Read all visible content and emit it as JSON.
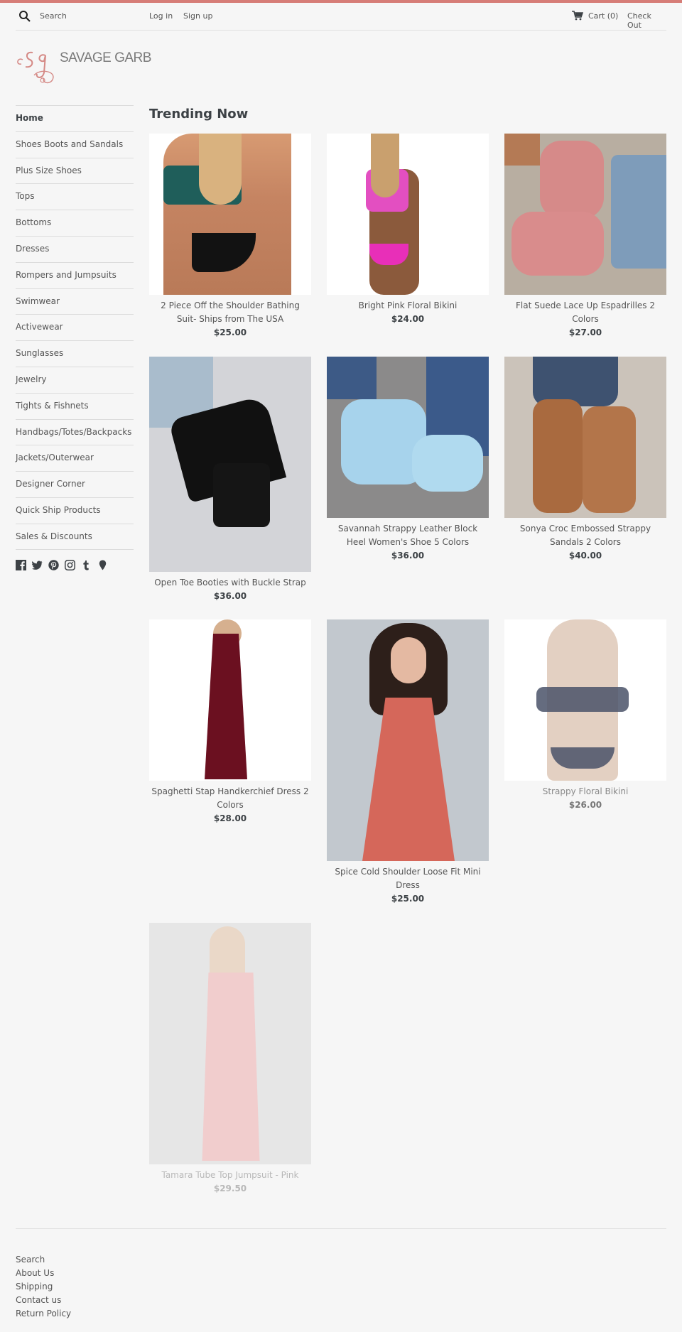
{
  "header": {
    "search_placeholder": "Search",
    "login": "Log in",
    "signup": "Sign up",
    "cart": "Cart (0)",
    "checkout": "Check Out",
    "accent_color": "#d67d77"
  },
  "logo": {
    "monogram": "sg",
    "text": "SAVAGE GARB"
  },
  "sidebar": {
    "items": [
      {
        "label": "Home",
        "active": true
      },
      {
        "label": "Shoes Boots and Sandals"
      },
      {
        "label": "Plus Size Shoes"
      },
      {
        "label": "Tops"
      },
      {
        "label": "Bottoms"
      },
      {
        "label": "Dresses"
      },
      {
        "label": "Rompers and Jumpsuits"
      },
      {
        "label": "Swimwear"
      },
      {
        "label": "Activewear"
      },
      {
        "label": "Sunglasses"
      },
      {
        "label": "Jewelry"
      },
      {
        "label": "Tights & Fishnets"
      },
      {
        "label": "Handbags/Totes/Backpacks"
      },
      {
        "label": "Jackets/Outerwear"
      },
      {
        "label": "Designer Corner"
      },
      {
        "label": "Quick Ship Products"
      },
      {
        "label": "Sales & Discounts"
      }
    ],
    "social": [
      "facebook-icon",
      "twitter-icon",
      "pinterest-icon",
      "instagram-icon",
      "tumblr-icon",
      "periscope-icon"
    ]
  },
  "main": {
    "title": "Trending Now",
    "products": [
      {
        "name": "2 Piece Off the Shoulder Bathing Suit- Ships from The USA",
        "price": "$25.00"
      },
      {
        "name": "Bright Pink Floral Bikini",
        "price": "$24.00"
      },
      {
        "name": "Flat Suede Lace Up Espadrilles 2 Colors",
        "price": "$27.00"
      },
      {
        "name": "Open Toe Booties with Buckle Strap",
        "price": "$36.00"
      },
      {
        "name": "Savannah Strappy Leather Block Heel Women's Shoe 5 Colors",
        "price": "$36.00"
      },
      {
        "name": "Sonya Croc Embossed Strappy Sandals 2 Colors",
        "price": "$40.00"
      },
      {
        "name": "Spaghetti Stap Handkerchief Dress 2 Colors",
        "price": "$28.00"
      },
      {
        "name": "Spice Cold Shoulder Loose Fit Mini Dress",
        "price": "$25.00"
      },
      {
        "name": "Strappy Floral Bikini",
        "price": "$26.00"
      },
      {
        "name": "Tamara Tube Top Jumpsuit - Pink",
        "price": "$29.50"
      }
    ]
  },
  "footer": {
    "links": [
      "Search",
      "About Us",
      "Shipping",
      "Contact us",
      "Return Policy"
    ]
  }
}
